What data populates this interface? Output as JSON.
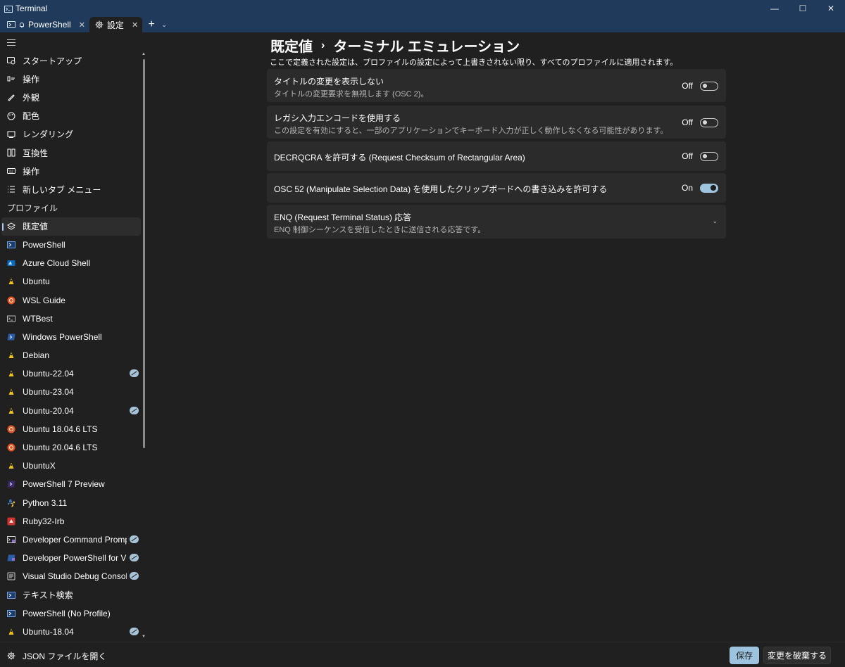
{
  "window": {
    "title": "Terminal",
    "minimize_glyph": "—",
    "maximize_glyph": "☐",
    "close_glyph": "✕"
  },
  "tabs": [
    {
      "label": "PowerShell",
      "icon": "powershell-icon",
      "close": "✕"
    },
    {
      "label": "設定",
      "icon": "gear-icon",
      "close": "✕"
    }
  ],
  "tabbar": {
    "new_tab": "+",
    "dropdown": "⌄"
  },
  "sidebar": {
    "settings_items": [
      {
        "label": "スタートアップ",
        "icon": "startup-icon"
      },
      {
        "label": "操作",
        "icon": "interaction-icon"
      },
      {
        "label": "外観",
        "icon": "appearance-icon"
      },
      {
        "label": "配色",
        "icon": "color-scheme-icon"
      },
      {
        "label": "レンダリング",
        "icon": "rendering-icon"
      },
      {
        "label": "互換性",
        "icon": "compatibility-icon"
      },
      {
        "label": "操作",
        "icon": "actions-icon"
      },
      {
        "label": "新しいタブ メニュー",
        "icon": "new-tab-menu-icon"
      }
    ],
    "profiles_header": "プロファイル",
    "profiles": [
      {
        "label": "既定値",
        "icon": "defaults-icon",
        "selected": true,
        "hidden": false
      },
      {
        "label": "PowerShell",
        "icon": "powershell-icon",
        "selected": false,
        "hidden": false
      },
      {
        "label": "Azure Cloud Shell",
        "icon": "azure-icon",
        "selected": false,
        "hidden": false
      },
      {
        "label": "Ubuntu",
        "icon": "linux-icon",
        "selected": false,
        "hidden": false
      },
      {
        "label": "WSL Guide",
        "icon": "ubuntu-icon",
        "selected": false,
        "hidden": false
      },
      {
        "label": "WTBest",
        "icon": "terminal-icon",
        "selected": false,
        "hidden": false
      },
      {
        "label": "Windows PowerShell",
        "icon": "windows-powershell-icon",
        "selected": false,
        "hidden": false
      },
      {
        "label": "Debian",
        "icon": "linux-icon",
        "selected": false,
        "hidden": false
      },
      {
        "label": "Ubuntu-22.04",
        "icon": "linux-icon",
        "selected": false,
        "hidden": true
      },
      {
        "label": "Ubuntu-23.04",
        "icon": "linux-icon",
        "selected": false,
        "hidden": false
      },
      {
        "label": "Ubuntu-20.04",
        "icon": "linux-icon",
        "selected": false,
        "hidden": true
      },
      {
        "label": "Ubuntu 18.04.6 LTS",
        "icon": "ubuntu-icon",
        "selected": false,
        "hidden": false
      },
      {
        "label": "Ubuntu 20.04.6 LTS",
        "icon": "ubuntu-icon",
        "selected": false,
        "hidden": false
      },
      {
        "label": "UbuntuX",
        "icon": "linux-icon",
        "selected": false,
        "hidden": false
      },
      {
        "label": "PowerShell 7 Preview",
        "icon": "powershell-preview-icon",
        "selected": false,
        "hidden": false
      },
      {
        "label": "Python 3.11",
        "icon": "python-icon",
        "selected": false,
        "hidden": false
      },
      {
        "label": "Ruby32-Irb",
        "icon": "ruby-icon",
        "selected": false,
        "hidden": false
      },
      {
        "label": "Developer Command Prompt",
        "icon": "developer-cmd-icon",
        "selected": false,
        "hidden": true
      },
      {
        "label": "Developer PowerShell for VS",
        "icon": "developer-powershell-icon",
        "selected": false,
        "hidden": true
      },
      {
        "label": "Visual Studio Debug Console",
        "icon": "debug-console-icon",
        "selected": false,
        "hidden": true
      },
      {
        "label": "テキスト検索",
        "icon": "powershell-icon",
        "selected": false,
        "hidden": false
      },
      {
        "label": "PowerShell (No Profile)",
        "icon": "powershell-icon",
        "selected": false,
        "hidden": false
      },
      {
        "label": "Ubuntu-18.04",
        "icon": "linux-icon",
        "selected": false,
        "hidden": true
      }
    ],
    "open_json": "JSON ファイルを開く"
  },
  "main": {
    "breadcrumb": [
      "既定値",
      "ターミナル エミュレーション"
    ],
    "breadcrumb_sep": "›",
    "description": "ここで定義された設定は、プロファイルの設定によって上書きされない限り、すべてのプロファイルに適用されます。",
    "settings": [
      {
        "title": "タイトルの変更を表示しない",
        "subtitle": "タイトルの変更要求を無視します (OSC 2)。",
        "state": "Off",
        "on": false
      },
      {
        "title": "レガシ入力エンコードを使用する",
        "subtitle": "この設定を有効にすると、一部のアプリケーションでキーボード入力が正しく動作しなくなる可能性があります。",
        "state": "Off",
        "on": false
      },
      {
        "title": "DECRQCRA を許可する (Request Checksum of Rectangular Area)",
        "subtitle": "",
        "state": "Off",
        "on": false
      },
      {
        "title": "OSC 52 (Manipulate Selection Data) を使用したクリップボードへの書き込みを許可する",
        "subtitle": "",
        "state": "On",
        "on": true
      },
      {
        "title": "ENQ (Request Terminal Status) 応答",
        "subtitle": "ENQ 制御シーケンスを受信したときに送信される応答です。",
        "expander": "⌄"
      }
    ]
  },
  "footer": {
    "save": "保存",
    "discard": "変更を破棄する"
  },
  "colors": {
    "accent": "#9ec3df",
    "titlebar": "#1f3a5a",
    "background": "#202020",
    "card": "#2b2b2b"
  }
}
